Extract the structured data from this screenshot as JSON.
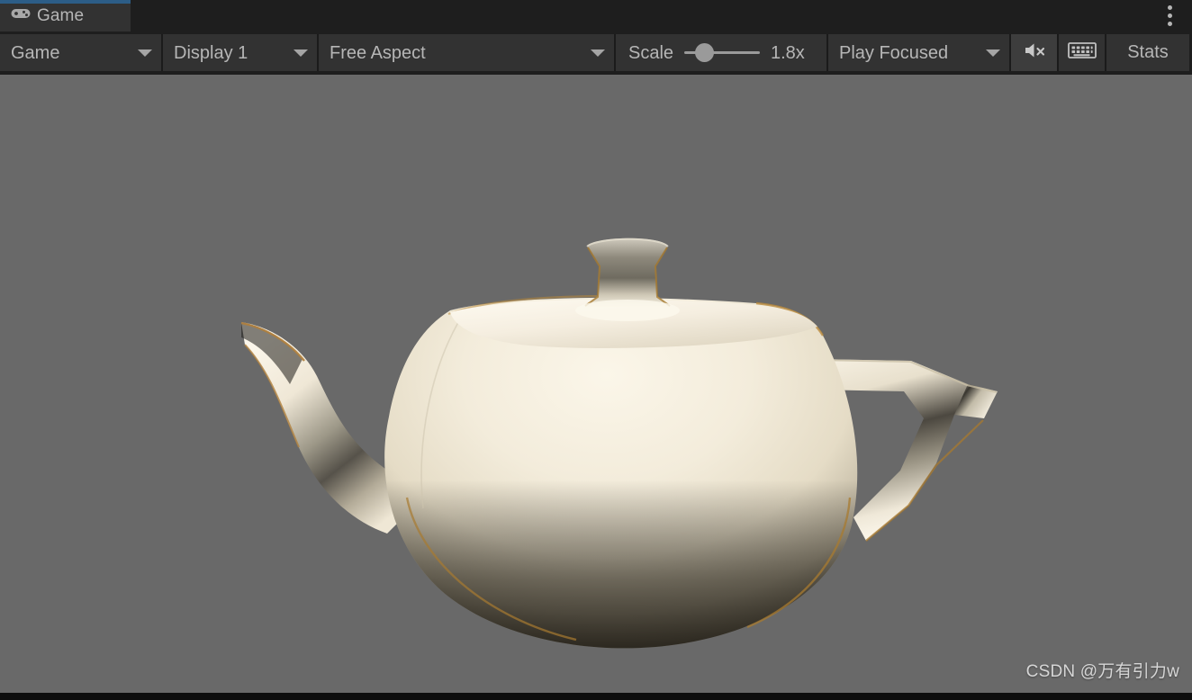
{
  "window": {
    "title": "Game",
    "kebab_menu_label": "⋮"
  },
  "tabs": [
    {
      "label": "Game",
      "icon": "gamepad-icon",
      "active": true
    }
  ],
  "toolbar": {
    "view_dropdown": {
      "label": "Game",
      "icon": "chevron-down-icon"
    },
    "display_dropdown": {
      "label": "Display 1",
      "icon": "chevron-down-icon"
    },
    "aspect_dropdown": {
      "label": "Free Aspect",
      "icon": "chevron-down-icon"
    },
    "scale": {
      "label": "Scale",
      "value": "1.8x",
      "slider_percent": 18
    },
    "play_mode_dropdown": {
      "label": "Play Focused",
      "icon": "chevron-down-icon"
    },
    "mute_audio": {
      "icon": "mute-audio-icon",
      "active": true,
      "label": ""
    },
    "gizmos": {
      "icon": "gizmos-grid-icon",
      "active": false,
      "label": ""
    },
    "stats_button": {
      "label": "Stats"
    }
  },
  "gameview": {
    "background_color": "#696969",
    "object": "utah-teapot",
    "watermark": "CSDN @万有引力w"
  },
  "colors": {
    "accent": "#2c5d87",
    "panel": "#1e1e1e",
    "control": "#323232",
    "control_active": "#3d3d3d",
    "text": "#b6b6b6",
    "viewport": "#696969",
    "teapot_light": "#f2ecdd",
    "teapot_rim": "#b8823c"
  }
}
